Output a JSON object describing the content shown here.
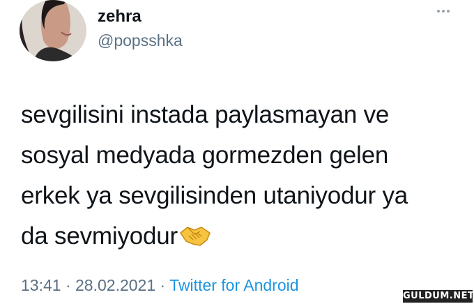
{
  "header": {
    "display_name": "zehra",
    "handle": "@popsshka"
  },
  "tweet": {
    "lines": [
      "sevgilisini instada paylasmayan ve",
      "sosyal medyada gormezden gelen",
      "erkek ya sevgilisinden utaniyodur ya",
      "da sevmiyodur"
    ],
    "emoji": "handshake-icon"
  },
  "meta": {
    "time": "13:41",
    "sep1": " · ",
    "date": "28.02.2021",
    "sep2": " · ",
    "source": "Twitter for Android"
  },
  "watermark": "GULDUM.NET",
  "colors": {
    "text": "#0f1419",
    "secondary": "#5b7083",
    "link": "#1b95e0"
  }
}
